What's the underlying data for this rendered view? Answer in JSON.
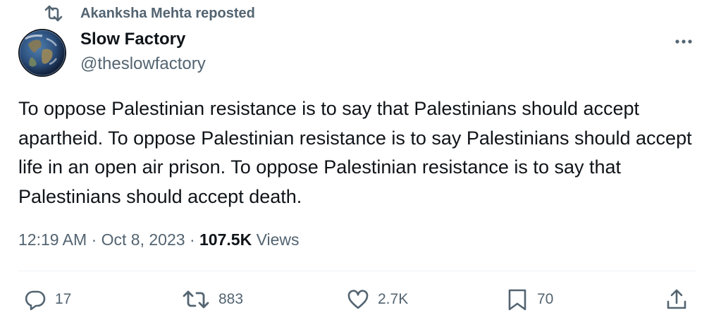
{
  "repost_header": {
    "text": "Akanksha Mehta reposted"
  },
  "author": {
    "name": "Slow Factory",
    "handle": "@theslowfactory",
    "avatar_icon": "earth-globe-avatar"
  },
  "more_icon": "more-horizontal-icon",
  "tweet": {
    "text": "To oppose Palestinian resistance is to say that Palestinians should accept apartheid. To oppose Palestinian resistance is to say Palestinians should accept life in an open air prison. To oppose Palestinian resistance is to say that Palestinians should accept death."
  },
  "meta": {
    "time": "12:19 AM",
    "separator": " · ",
    "date": "Oct 8, 2023",
    "views_count": "107.5K",
    "views_label": " Views"
  },
  "actions": {
    "reply": {
      "icon": "reply-icon",
      "count": "17"
    },
    "repost": {
      "icon": "repost-icon",
      "count": "883"
    },
    "like": {
      "icon": "heart-icon",
      "count": "2.7K"
    },
    "bookmark": {
      "icon": "bookmark-icon",
      "count": "70"
    },
    "share": {
      "icon": "share-icon"
    }
  },
  "colors": {
    "text_primary": "#0f1419",
    "text_secondary": "#536471",
    "divider": "#eff3f4"
  }
}
